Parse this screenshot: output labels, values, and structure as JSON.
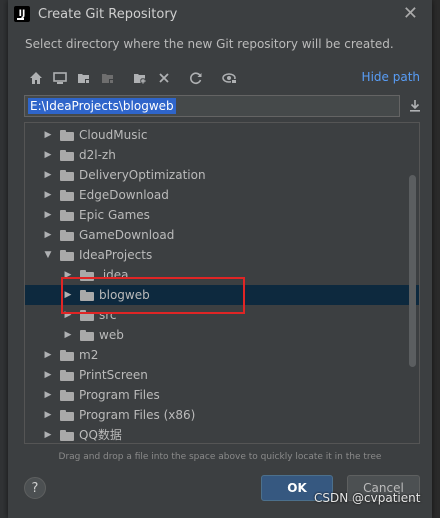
{
  "dialog": {
    "title": "Create Git Repository",
    "subtitle": "Select directory where the new Git repository will be created.",
    "close_glyph": "✕"
  },
  "toolbar": {
    "hide_path_label": "Hide path",
    "icons": [
      "home-icon",
      "desktop-icon",
      "project-folder-icon",
      "module-folder-icon",
      "new-folder-icon",
      "delete-icon",
      "refresh-icon",
      "show-hidden-icon"
    ]
  },
  "path": {
    "value": "E:\\IdeaProjects\\blogweb"
  },
  "tree": {
    "items": [
      {
        "label": "CloudMusic",
        "depth": 0,
        "expanded": false
      },
      {
        "label": "d2l-zh",
        "depth": 0,
        "expanded": false
      },
      {
        "label": "DeliveryOptimization",
        "depth": 0,
        "expanded": false
      },
      {
        "label": "EdgeDownload",
        "depth": 0,
        "expanded": false
      },
      {
        "label": "Epic Games",
        "depth": 0,
        "expanded": false
      },
      {
        "label": "GameDownload",
        "depth": 0,
        "expanded": false
      },
      {
        "label": "IdeaProjects",
        "depth": 0,
        "expanded": true
      },
      {
        "label": ".idea",
        "depth": 1,
        "expanded": false
      },
      {
        "label": "blogweb",
        "depth": 1,
        "expanded": false,
        "selected": true
      },
      {
        "label": "src",
        "depth": 1,
        "expanded": false
      },
      {
        "label": "web",
        "depth": 1,
        "expanded": false
      },
      {
        "label": "m2",
        "depth": 0,
        "expanded": false
      },
      {
        "label": "PrintScreen",
        "depth": 0,
        "expanded": false
      },
      {
        "label": "Program Files",
        "depth": 0,
        "expanded": false
      },
      {
        "label": "Program Files (x86)",
        "depth": 0,
        "expanded": false
      },
      {
        "label": "QQ数据",
        "depth": 0,
        "expanded": false
      }
    ]
  },
  "hint": "Drag and drop a file into the space above to quickly locate it in the tree",
  "buttons": {
    "help": "?",
    "ok": "OK",
    "cancel": "Cancel"
  },
  "watermark": "CSDN @cvpatient",
  "colors": {
    "accent": "#589df6",
    "selection": "#0d293e",
    "ok_button": "#365880",
    "annotation": "#e02525"
  }
}
